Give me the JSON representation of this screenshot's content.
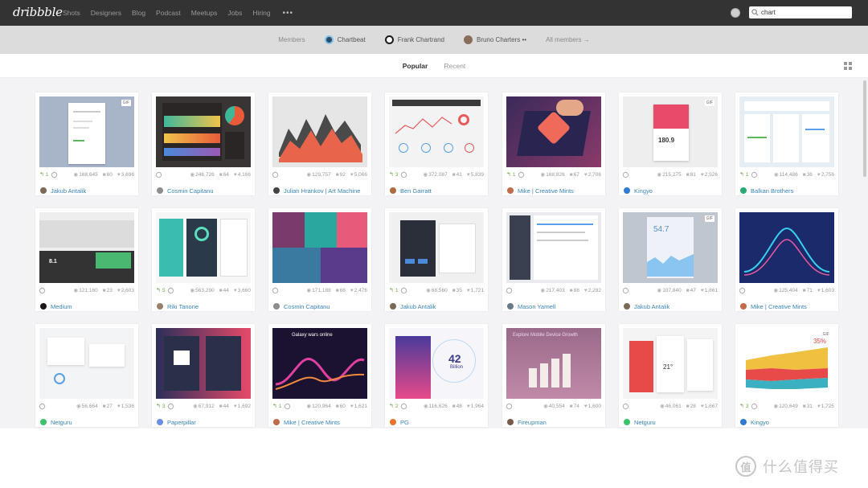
{
  "header": {
    "logo": "dribbble",
    "nav": [
      "Shots",
      "Designers",
      "Blog",
      "Podcast",
      "Meetups",
      "Jobs",
      "Hiring"
    ],
    "more": "•••",
    "search_value": "chart"
  },
  "members_bar": {
    "label": "Members",
    "members": [
      {
        "name": "Chartbeat",
        "color": "#2d4a66"
      },
      {
        "name": "Frank Chartrand",
        "color": "#1a1a1a"
      },
      {
        "name": "Bruno Charters ••",
        "color": "#8a6d5a"
      }
    ],
    "all": "All members →"
  },
  "tabs": {
    "popular": "Popular",
    "recent": "Recent"
  },
  "shots": [
    {
      "gif": true,
      "rebounds": "1",
      "views": "168,645",
      "comments": "60",
      "likes": "3,696",
      "author": "Jakub Antalik",
      "avatar": "#7a6a5a"
    },
    {
      "gif": false,
      "rebounds": "",
      "views": "246,726",
      "comments": "64",
      "likes": "4,166",
      "author": "Cosmin Capitanu",
      "avatar": "#8e8e8e"
    },
    {
      "gif": false,
      "rebounds": "",
      "views": "129,757",
      "comments": "92",
      "likes": "5,066",
      "author": "Julian Hrankov | Art Machine",
      "avatar": "#444444"
    },
    {
      "gif": false,
      "rebounds": "3",
      "views": "372,087",
      "comments": "41",
      "likes": "5,839",
      "author": "Ben Garratt",
      "avatar": "#b06a40"
    },
    {
      "gif": false,
      "rebounds": "1",
      "views": "168,826",
      "comments": "67",
      "likes": "2,706",
      "author": "Mike | Creative Mints",
      "avatar": "#c46a4a"
    },
    {
      "gif": true,
      "rebounds": "",
      "views": "215,275",
      "comments": "81",
      "likes": "2,526",
      "author": "Kingyo",
      "avatar": "#2f7bd1"
    },
    {
      "gif": false,
      "rebounds": "1",
      "views": "114,486",
      "comments": "36",
      "likes": "2,756",
      "author": "Balkan Brothers",
      "avatar": "#2aa876"
    },
    {
      "gif": false,
      "rebounds": "",
      "views": "121,160",
      "comments": "23",
      "likes": "2,603",
      "author": "Medium",
      "avatar": "#1a1a1a"
    },
    {
      "gif": false,
      "rebounds": "5",
      "views": "563,290",
      "comments": "44",
      "likes": "3,660",
      "author": "Riki Tanone",
      "avatar": "#9a7f6a"
    },
    {
      "gif": false,
      "rebounds": "",
      "views": "171,188",
      "comments": "66",
      "likes": "2,476",
      "author": "Cosmin Capitanu",
      "avatar": "#8e8e8e"
    },
    {
      "gif": false,
      "rebounds": "1",
      "views": "68,560",
      "comments": "35",
      "likes": "1,721",
      "author": "Jakub Antalik",
      "avatar": "#7a6a5a"
    },
    {
      "gif": false,
      "rebounds": "",
      "views": "217,403",
      "comments": "88",
      "likes": "2,292",
      "author": "Mason Yarnell",
      "avatar": "#6a7a8a"
    },
    {
      "gif": true,
      "rebounds": "",
      "views": "107,840",
      "comments": "47",
      "likes": "1,861",
      "author": "Jakub Antalik",
      "avatar": "#7a6a5a"
    },
    {
      "gif": false,
      "rebounds": "",
      "views": "125,404",
      "comments": "71",
      "likes": "1,603",
      "author": "Mike | Creative Mints",
      "avatar": "#c46a4a"
    },
    {
      "gif": false,
      "rebounds": "",
      "views": "56,664",
      "comments": "27",
      "likes": "1,536",
      "author": "Netguru",
      "avatar": "#3cc46a"
    },
    {
      "gif": false,
      "rebounds": "3",
      "views": "67,912",
      "comments": "44",
      "likes": "1,692",
      "author": "Paperpillar",
      "avatar": "#6a8fe8"
    },
    {
      "gif": false,
      "rebounds": "1",
      "views": "120,964",
      "comments": "60",
      "likes": "1,621",
      "author": "Mike | Creative Mints",
      "avatar": "#c46a4a"
    },
    {
      "gif": false,
      "rebounds": "2",
      "views": "116,626",
      "comments": "48",
      "likes": "1,964",
      "author": "PG",
      "avatar": "#e8732a"
    },
    {
      "gif": false,
      "rebounds": "",
      "views": "40,554",
      "comments": "74",
      "likes": "1,600",
      "author": "Fireupman",
      "avatar": "#7a5a4a"
    },
    {
      "gif": false,
      "rebounds": "",
      "views": "46,061",
      "comments": "28",
      "likes": "1,667",
      "author": "Netguru",
      "avatar": "#3cc46a"
    },
    {
      "gif": true,
      "rebounds": "3",
      "views": "120,649",
      "comments": "31",
      "likes": "1,725",
      "author": "Kingyo",
      "avatar": "#2f7bd1"
    }
  ],
  "thumb_text": {
    "t5_value": "180.9",
    "t7_value": "8.1",
    "t12_value": "54.7",
    "t15_title": "Galaxy wars online",
    "t17_value": "42",
    "t17_unit": "Billion",
    "t18_title": "Explore Mobile Device Growth",
    "t19_value": "21°",
    "t20_value": "35%"
  },
  "watermark": {
    "mark": "值",
    "text": "什么值得买"
  }
}
